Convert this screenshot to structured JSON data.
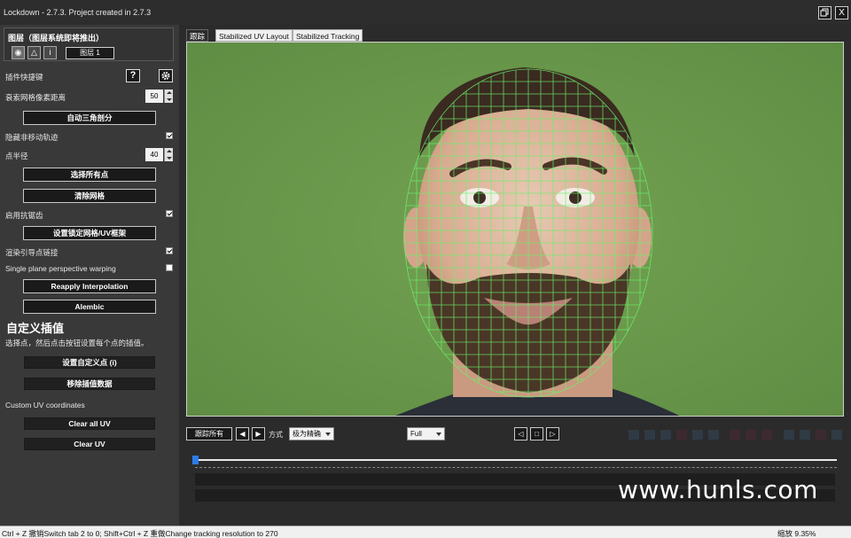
{
  "window": {
    "title": "Lockdown - 2.7.3. Project created in 2.7.3",
    "restore_icon": "restore-icon",
    "close_label": "X"
  },
  "layer": {
    "label": "图层（图层系统即将推出）",
    "modes": [
      {
        "icon": "eye-icon",
        "glyph": "◉"
      },
      {
        "icon": "triangle-icon",
        "glyph": "△"
      },
      {
        "icon": "info-icon",
        "glyph": "i"
      }
    ],
    "name": "图层 1"
  },
  "panel": {
    "plugin_shortcut": "插件快捷键",
    "help_label": "?",
    "pixel_distance_label": "衰索网格像素距离",
    "pixel_distance_value": "50",
    "auto_triangulate": "自动三角剖分",
    "hide_nonmoving_label": "隐藏非移动轨迹",
    "hide_nonmoving_checked": true,
    "point_radius_label": "点半径",
    "point_radius_value": "40",
    "select_all_points": "选择所有点",
    "clear_mesh": "清除网格",
    "enable_antialias_label": "启用抗锯齿",
    "enable_antialias_checked": true,
    "set_locked_mesh": "设置锁定网格/UV框架",
    "render_guide_links_label": "渲染引导点链接",
    "render_guide_links_checked": true,
    "single_plane_label": "Single plane perspective warping",
    "single_plane_checked": false,
    "reapply_interpolation": "Reapply Interpolation",
    "alembic": "Alembic",
    "custom_interp_title": "自定义插值",
    "custom_interp_desc": "选择点，然后点击按钮设置每个点的插值。",
    "set_custom_point": "设置自定义点 (i)",
    "remove_interp_data": "移除插值数据",
    "custom_uv_label": "Custom UV coordinates",
    "clear_all_uv": "Clear all UV",
    "clear_uv": "Clear UV"
  },
  "tabs": [
    {
      "label": "跟踪",
      "active": true
    },
    {
      "label": "Stabilized UV Layout",
      "active": false
    },
    {
      "label": "Stabilized Tracking",
      "active": false
    }
  ],
  "controls": {
    "track_all": "跟踪所有",
    "prev_glyph": "◀",
    "next_glyph": "▶",
    "mode_label": "方式",
    "mode_value": "极为精确",
    "resolution_value": "Full",
    "nav_prev": "◁",
    "nav_stop": "□",
    "nav_next": "▷"
  },
  "watermark": "www.hunls.com",
  "status": {
    "left": "Ctrl + Z  撤销Switch tab 2 to 0; Shift+Ctrl + Z  重做Change tracking resolution to 270",
    "zoom": "缩放 9.35%"
  },
  "colors": {
    "green_screen": "#6e9a4f",
    "mesh": "#6cf06c",
    "timeline_head": "#2d7ce8"
  }
}
